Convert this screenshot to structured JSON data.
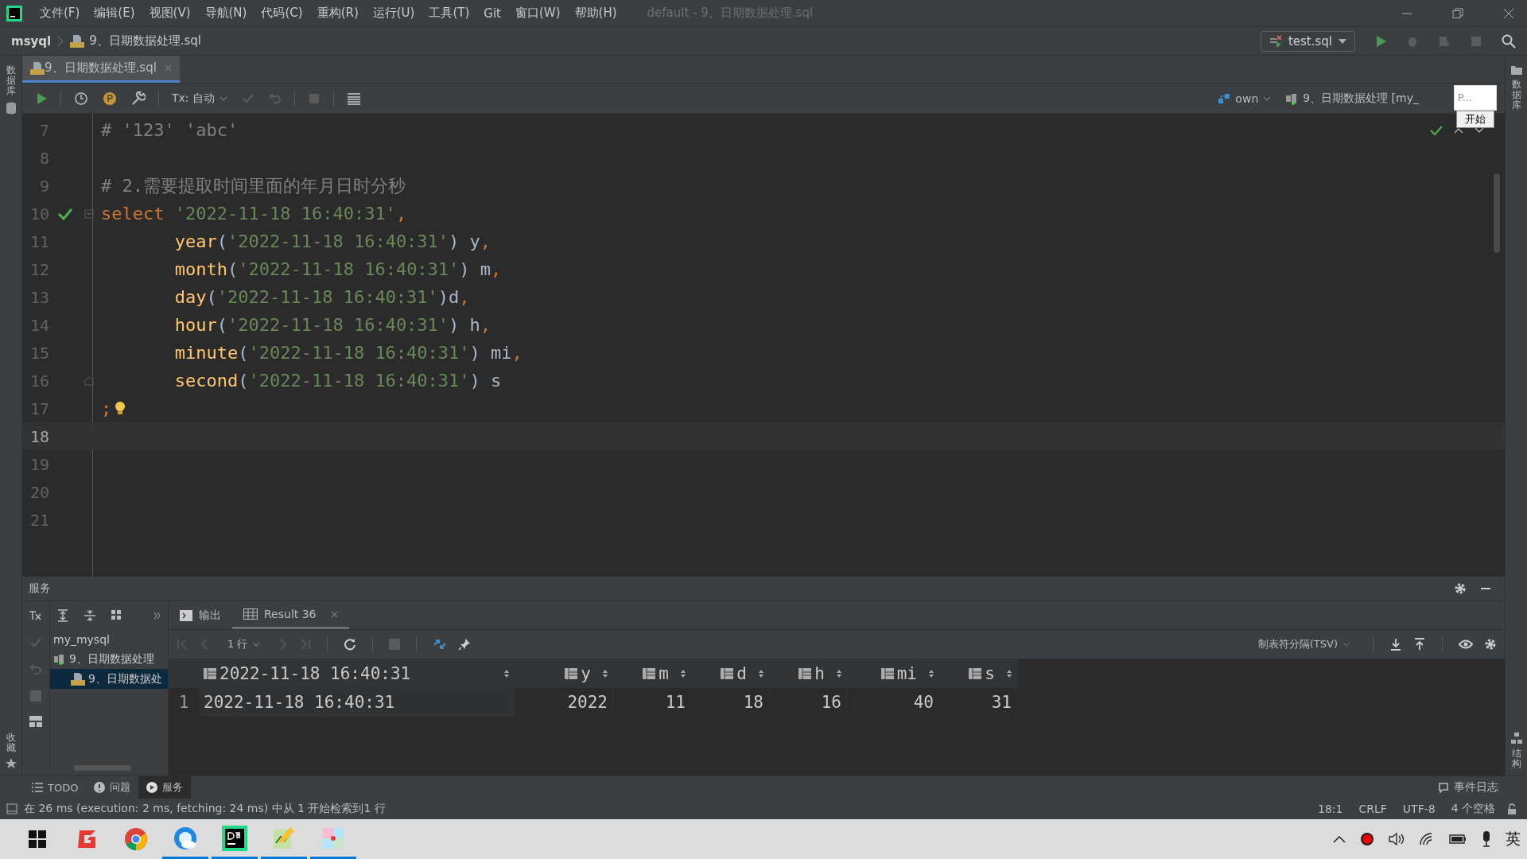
{
  "title_bar": {
    "menu": [
      "文件(F)",
      "编辑(E)",
      "视图(V)",
      "导航(N)",
      "代码(C)",
      "重构(R)",
      "运行(U)",
      "工具(T)",
      "Git",
      "窗口(W)",
      "帮助(H)"
    ],
    "title": "default - 9、日期数据处理.sql"
  },
  "nav_bar": {
    "project": "msyql",
    "file": "9、日期数据处理.sql",
    "run_config": "test.sql"
  },
  "left_stripe": {
    "top": "数据库",
    "bottom": "收藏"
  },
  "right_stripe": {
    "top": "数据库",
    "bottom": "结构"
  },
  "editor_tabs": [
    {
      "label": "9、日期数据处理.sql",
      "selected": true
    }
  ],
  "editor_toolbar": {
    "tx_mode": "Tx: 自动",
    "schema": "own",
    "session": "9、日期数据处理 [my_"
  },
  "popup": {
    "value": "P...",
    "button": "开始"
  },
  "editor": {
    "lines": [
      {
        "number": "7",
        "current": false,
        "ok": false,
        "fold_start": false,
        "fold_end": false,
        "hint": false,
        "tokens": [
          {
            "kind": "comment",
            "text": "# '123' 'abc'"
          }
        ]
      },
      {
        "number": "8",
        "current": false,
        "ok": false,
        "fold_start": false,
        "fold_end": false,
        "hint": false
      },
      {
        "number": "9",
        "current": false,
        "ok": false,
        "fold_start": false,
        "fold_end": false,
        "hint": false,
        "tokens": [
          {
            "kind": "comment",
            "text": "# 2.需要提取时间里面的年月日时分秒"
          }
        ]
      },
      {
        "number": "10",
        "current": false,
        "ok": true,
        "fold_start": true,
        "fold_end": false,
        "hint": false,
        "tokens": [
          {
            "kind": "keyword",
            "text": "select "
          },
          {
            "kind": "string",
            "text": "'2022-11-18 16:40:31'"
          },
          {
            "kind": "keyword",
            "text": ","
          }
        ]
      },
      {
        "number": "11",
        "current": false,
        "ok": false,
        "fold_start": false,
        "fold_end": false,
        "hint": false,
        "tokens": [
          {
            "kind": "func",
            "text": "       year"
          },
          {
            "kind": "plain",
            "text": "("
          },
          {
            "kind": "string",
            "text": "'2022-11-18 16:40:31'"
          },
          {
            "kind": "plain",
            "text": ") y"
          },
          {
            "kind": "keyword",
            "text": ","
          }
        ]
      },
      {
        "number": "12",
        "current": false,
        "ok": false,
        "fold_start": false,
        "fold_end": false,
        "hint": false,
        "tokens": [
          {
            "kind": "func",
            "text": "       month"
          },
          {
            "kind": "plain",
            "text": "("
          },
          {
            "kind": "string",
            "text": "'2022-11-18 16:40:31'"
          },
          {
            "kind": "plain",
            "text": ") m"
          },
          {
            "kind": "keyword",
            "text": ","
          }
        ]
      },
      {
        "number": "13",
        "current": false,
        "ok": false,
        "fold_start": false,
        "fold_end": false,
        "hint": false,
        "tokens": [
          {
            "kind": "func",
            "text": "       day"
          },
          {
            "kind": "plain",
            "text": "("
          },
          {
            "kind": "string",
            "text": "'2022-11-18 16:40:31'"
          },
          {
            "kind": "plain",
            "text": ")d"
          },
          {
            "kind": "keyword",
            "text": ","
          }
        ]
      },
      {
        "number": "14",
        "current": false,
        "ok": false,
        "fold_start": false,
        "fold_end": false,
        "hint": false,
        "tokens": [
          {
            "kind": "func",
            "text": "       hour"
          },
          {
            "kind": "plain",
            "text": "("
          },
          {
            "kind": "string",
            "text": "'2022-11-18 16:40:31'"
          },
          {
            "kind": "plain",
            "text": ") h"
          },
          {
            "kind": "keyword",
            "text": ","
          }
        ]
      },
      {
        "number": "15",
        "current": false,
        "ok": false,
        "fold_start": false,
        "fold_end": false,
        "hint": false,
        "tokens": [
          {
            "kind": "func",
            "text": "       minute"
          },
          {
            "kind": "plain",
            "text": "("
          },
          {
            "kind": "string",
            "text": "'2022-11-18 16:40:31'"
          },
          {
            "kind": "plain",
            "text": ") mi"
          },
          {
            "kind": "keyword",
            "text": ","
          }
        ]
      },
      {
        "number": "16",
        "current": false,
        "ok": false,
        "fold_start": false,
        "fold_end": true,
        "hint": false,
        "tokens": [
          {
            "kind": "func",
            "text": "       second"
          },
          {
            "kind": "plain",
            "text": "("
          },
          {
            "kind": "string",
            "text": "'2022-11-18 16:40:31'"
          },
          {
            "kind": "plain",
            "text": ") s"
          }
        ]
      },
      {
        "number": "17",
        "current": false,
        "ok": false,
        "fold_start": false,
        "fold_end": false,
        "hint": true,
        "tokens": [
          {
            "kind": "keyword",
            "text": ";"
          }
        ]
      },
      {
        "number": "18",
        "current": true,
        "ok": false,
        "fold_start": false,
        "fold_end": false,
        "hint": false
      },
      {
        "number": "19",
        "current": false,
        "ok": false,
        "fold_start": false,
        "fold_end": false,
        "hint": false
      },
      {
        "number": "20",
        "current": false,
        "ok": false,
        "fold_start": false,
        "fold_end": false,
        "hint": false
      },
      {
        "number": "21",
        "current": false,
        "ok": false,
        "fold_start": false,
        "fold_end": false,
        "hint": false
      }
    ]
  },
  "services": {
    "title": "服务",
    "tree": [
      {
        "label": "my_mysql",
        "selected": false,
        "children": [
          {
            "label": "9、日期数据处理",
            "selected": false,
            "children": [
              {
                "label": "9、日期数据处",
                "selected": true
              }
            ]
          }
        ]
      }
    ]
  },
  "result_tabs": [
    {
      "label": "输出",
      "selected": false
    },
    {
      "label": "Result 36",
      "selected": true
    }
  ],
  "result_toolbar": {
    "rows": "1 行",
    "format": "制表符分隔(TSV)"
  },
  "table": {
    "columns": [
      "2022-11-18 16:40:31",
      "y",
      "m",
      "d",
      "h",
      "mi",
      "s"
    ],
    "rows": [
      {
        "number": "1",
        "cells": [
          "2022-11-18 16:40:31",
          "2022",
          "11",
          "18",
          "16",
          "40",
          "31"
        ]
      }
    ]
  },
  "tool_tabs": [
    {
      "label": "TODO",
      "selected": false
    },
    {
      "label": "问题",
      "selected": false
    },
    {
      "label": "服务",
      "selected": true
    }
  ],
  "event_log": "事件日志",
  "status_bar": {
    "message": "在 26 ms (execution: 2 ms, fetching: 24 ms) 中从 1 开始检索到1 行",
    "position": "18:1",
    "line_separator": "CRLF",
    "encoding": "UTF-8",
    "indent": "4 个空格"
  },
  "taskbar": {
    "ime": "英"
  }
}
